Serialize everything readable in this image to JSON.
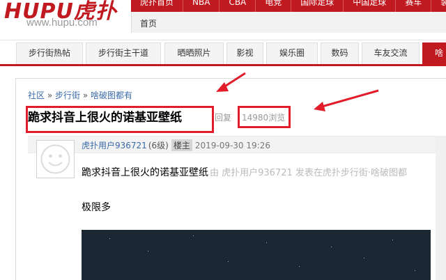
{
  "header": {
    "logo_text": "HUPU虎扑",
    "logo_url": "www.hupu.com",
    "top_nav": [
      "虎扑首页",
      "NBA",
      "CBA",
      "电竞",
      "国际足球",
      "中国足球",
      "赛车",
      "装备"
    ],
    "sub_nav": [
      "首页"
    ]
  },
  "tabs": [
    "步行街热帖",
    "步行街主干道",
    "晒晒照片",
    "影视",
    "娱乐圈",
    "数码",
    "车友交流",
    "啥"
  ],
  "colors": {
    "brand_red": "#c01920",
    "annotation_red": "#e21c2a",
    "link_blue": "#3a6aa8"
  },
  "breadcrumb": {
    "items": [
      "社区",
      "步行街",
      "啥破图都有"
    ],
    "separator": "»"
  },
  "thread": {
    "title": "跪求抖音上很火的诺基亚壁纸",
    "reply_label": "回复",
    "views_count": "14980",
    "views_label": "浏览"
  },
  "post": {
    "author": "虎扑用户936721",
    "level": "(6级)",
    "badge": "楼主",
    "timestamp": "2019-09-30 19:26",
    "title": "跪求抖音上很火的诺基亚壁纸",
    "byline": "由 虎扑用户936721 发表在虎扑步行街·啥破图都",
    "body": "极限多"
  }
}
